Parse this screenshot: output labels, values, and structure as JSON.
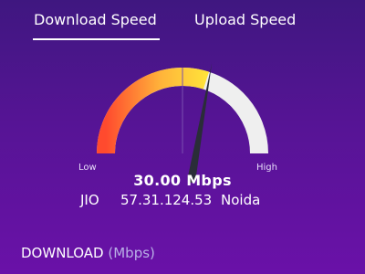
{
  "tabs": {
    "download_label": "Download Speed",
    "upload_label": "Upload Speed",
    "active": "download"
  },
  "gauge": {
    "low_label": "Low",
    "high_label": "High",
    "level": 0.6,
    "colors": {
      "start": "#ff4a2e",
      "middle": "#ffb43a",
      "end": "#ffe23a",
      "track": "#efefef",
      "needle": "#2a2d38"
    }
  },
  "result": {
    "speed": "30.00 Mbps",
    "isp": "JIO",
    "ip": "57.31.124.53",
    "city": "Noida"
  },
  "download_section": {
    "title": "DOWNLOAD",
    "unit": "(Mbps)"
  },
  "colors": {
    "background_top": "#3f1780",
    "background_bottom": "#6a11a8",
    "accent_unit": "#b9b0e6"
  }
}
